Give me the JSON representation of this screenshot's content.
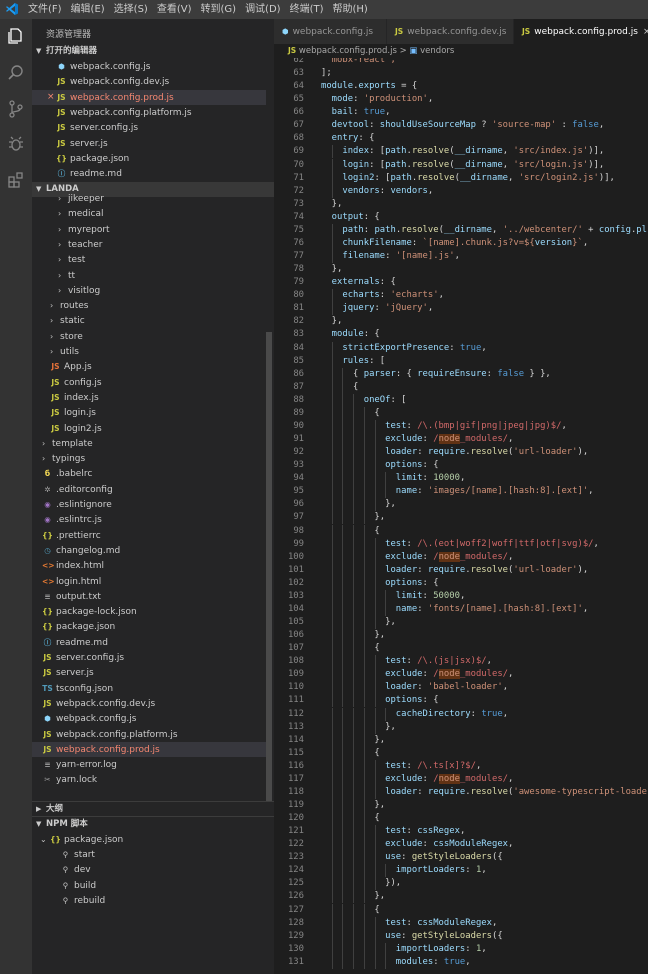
{
  "menu": [
    "文件(F)",
    "编辑(E)",
    "选择(S)",
    "查看(V)",
    "转到(G)",
    "调试(D)",
    "终端(T)",
    "帮助(H)"
  ],
  "sidebar_title": "资源管理器",
  "open_editors_label": "打开的编辑器",
  "open_editors": [
    {
      "name": "webpack.config.js",
      "icon": "webpack-icon"
    },
    {
      "name": "webpack.config.dev.js",
      "icon": "js-icon"
    },
    {
      "name": "webpack.config.prod.js",
      "icon": "js-icon",
      "selected": true,
      "error": true
    },
    {
      "name": "webpack.config.platform.js",
      "icon": "js-icon"
    },
    {
      "name": "server.config.js",
      "icon": "js-icon"
    },
    {
      "name": "server.js",
      "icon": "js-icon"
    },
    {
      "name": "package.json",
      "icon": "json-icon"
    },
    {
      "name": "readme.md",
      "icon": "info-icon"
    }
  ],
  "project_label": "LANDA",
  "tree": [
    {
      "name": "jikeeper",
      "depth": 2,
      "folder": true
    },
    {
      "name": "medical",
      "depth": 2,
      "folder": true
    },
    {
      "name": "myreport",
      "depth": 2,
      "folder": true
    },
    {
      "name": "teacher",
      "depth": 2,
      "folder": true
    },
    {
      "name": "test",
      "depth": 2,
      "folder": true
    },
    {
      "name": "tt",
      "depth": 2,
      "folder": true
    },
    {
      "name": "visitlog",
      "depth": 2,
      "folder": true
    },
    {
      "name": "routes",
      "depth": 1,
      "folder": true
    },
    {
      "name": "static",
      "depth": 1,
      "folder": true
    },
    {
      "name": "store",
      "depth": 1,
      "folder": true
    },
    {
      "name": "utils",
      "depth": 1,
      "folder": true
    },
    {
      "name": "App.js",
      "depth": 1,
      "icon": "js-react-icon"
    },
    {
      "name": "config.js",
      "depth": 1,
      "icon": "js-icon"
    },
    {
      "name": "index.js",
      "depth": 1,
      "icon": "js-icon"
    },
    {
      "name": "login.js",
      "depth": 1,
      "icon": "js-icon"
    },
    {
      "name": "login2.js",
      "depth": 1,
      "icon": "js-icon"
    },
    {
      "name": "template",
      "depth": 0,
      "folder": true
    },
    {
      "name": "typings",
      "depth": 0,
      "folder": true
    },
    {
      "name": ".babelrc",
      "depth": 0,
      "icon": "babel-icon"
    },
    {
      "name": ".editorconfig",
      "depth": 0,
      "icon": "settings-icon"
    },
    {
      "name": ".eslintignore",
      "depth": 0,
      "icon": "eslint-icon"
    },
    {
      "name": ".eslintrc.js",
      "depth": 0,
      "icon": "eslint-icon"
    },
    {
      "name": ".prettierrc",
      "depth": 0,
      "icon": "json-icon"
    },
    {
      "name": "changelog.md",
      "depth": 0,
      "icon": "clock-icon"
    },
    {
      "name": "index.html",
      "depth": 0,
      "icon": "html-icon"
    },
    {
      "name": "login.html",
      "depth": 0,
      "icon": "html-icon"
    },
    {
      "name": "output.txt",
      "depth": 0,
      "icon": "text-icon"
    },
    {
      "name": "package-lock.json",
      "depth": 0,
      "icon": "json-icon"
    },
    {
      "name": "package.json",
      "depth": 0,
      "icon": "json-icon"
    },
    {
      "name": "readme.md",
      "depth": 0,
      "icon": "info-icon"
    },
    {
      "name": "server.config.js",
      "depth": 0,
      "icon": "js-icon"
    },
    {
      "name": "server.js",
      "depth": 0,
      "icon": "js-icon"
    },
    {
      "name": "tsconfig.json",
      "depth": 0,
      "icon": "ts-icon"
    },
    {
      "name": "webpack.config.dev.js",
      "depth": 0,
      "icon": "js-icon"
    },
    {
      "name": "webpack.config.js",
      "depth": 0,
      "icon": "webpack-icon"
    },
    {
      "name": "webpack.config.platform.js",
      "depth": 0,
      "icon": "js-icon"
    },
    {
      "name": "webpack.config.prod.js",
      "depth": 0,
      "icon": "js-icon",
      "selected": true,
      "error": true
    },
    {
      "name": "yarn-error.log",
      "depth": 0,
      "icon": "lines-icon"
    },
    {
      "name": "yarn.lock",
      "depth": 0,
      "icon": "yarn-icon"
    }
  ],
  "outline_label": "大纲",
  "npm_label": "NPM 脚本",
  "npm_package": "package.json",
  "npm_scripts": [
    "start",
    "dev",
    "build",
    "rebuild"
  ],
  "tabs": [
    {
      "name": "webpack.config.js",
      "icon": "webpack-icon"
    },
    {
      "name": "webpack.config.dev.js",
      "icon": "js-icon"
    },
    {
      "name": "webpack.config.prod.js",
      "icon": "js-icon",
      "active": true
    }
  ],
  "tab_close": "×",
  "breadcrumb": {
    "file": "webpack.config.prod.js",
    "sep": ">",
    "symbol": "vendors"
  },
  "code_start_line": 62,
  "code_lines": [
    [
      [
        "s",
        "  mobx-react',"
      ]
    ],
    [
      [
        "p",
        "];"
      ]
    ],
    [
      [
        "v",
        "module"
      ],
      [
        "p",
        "."
      ],
      [
        "v",
        "exports"
      ],
      [
        "p",
        " = {"
      ]
    ],
    [
      [
        "v",
        "  mode"
      ],
      [
        "p",
        ": "
      ],
      [
        "s",
        "'production'"
      ],
      [
        "p",
        ","
      ]
    ],
    [
      [
        "v",
        "  bail"
      ],
      [
        "p",
        ": "
      ],
      [
        "k",
        "true"
      ],
      [
        "p",
        ","
      ]
    ],
    [
      [
        "v",
        "  devtool"
      ],
      [
        "p",
        ": "
      ],
      [
        "v",
        "shouldUseSourceMap"
      ],
      [
        "p",
        " ? "
      ],
      [
        "s",
        "'source-map'"
      ],
      [
        "p",
        " : "
      ],
      [
        "k",
        "false"
      ],
      [
        "p",
        ","
      ]
    ],
    [
      [
        "v",
        "  entry"
      ],
      [
        "p",
        ": {"
      ]
    ],
    [
      [
        "v",
        "    index"
      ],
      [
        "p",
        ": ["
      ],
      [
        "v",
        "path"
      ],
      [
        "p",
        "."
      ],
      [
        "f",
        "resolve"
      ],
      [
        "p",
        "("
      ],
      [
        "v",
        "__dirname"
      ],
      [
        "p",
        ", "
      ],
      [
        "s",
        "'src/index.js'"
      ],
      [
        "p",
        ")],"
      ]
    ],
    [
      [
        "v",
        "    login"
      ],
      [
        "p",
        ": ["
      ],
      [
        "v",
        "path"
      ],
      [
        "p",
        "."
      ],
      [
        "f",
        "resolve"
      ],
      [
        "p",
        "("
      ],
      [
        "v",
        "__dirname"
      ],
      [
        "p",
        ", "
      ],
      [
        "s",
        "'src/login.js'"
      ],
      [
        "p",
        ")],"
      ]
    ],
    [
      [
        "v",
        "    login2"
      ],
      [
        "p",
        ": ["
      ],
      [
        "v",
        "path"
      ],
      [
        "p",
        "."
      ],
      [
        "f",
        "resolve"
      ],
      [
        "p",
        "("
      ],
      [
        "v",
        "__dirname"
      ],
      [
        "p",
        ", "
      ],
      [
        "s",
        "'src/login2.js'"
      ],
      [
        "p",
        ")],"
      ]
    ],
    [
      [
        "v",
        "    vendors"
      ],
      [
        "p",
        ": "
      ],
      [
        "v",
        "vendors"
      ],
      [
        "p",
        ","
      ]
    ],
    [
      [
        "p",
        "  },"
      ]
    ],
    [
      [
        "v",
        "  output"
      ],
      [
        "p",
        ": {"
      ]
    ],
    [
      [
        "v",
        "    path"
      ],
      [
        "p",
        ": "
      ],
      [
        "v",
        "path"
      ],
      [
        "p",
        "."
      ],
      [
        "f",
        "resolve"
      ],
      [
        "p",
        "("
      ],
      [
        "v",
        "__dirname"
      ],
      [
        "p",
        ", "
      ],
      [
        "s",
        "'../webcenter/'"
      ],
      [
        "p",
        " + "
      ],
      [
        "v",
        "config"
      ],
      [
        "p",
        "."
      ],
      [
        "v",
        "pl"
      ]
    ],
    [
      [
        "v",
        "    chunkFilename"
      ],
      [
        "p",
        ": "
      ],
      [
        "s",
        "`[name].chunk.js?v=${"
      ],
      [
        "v",
        "version"
      ],
      [
        "s",
        "}`"
      ],
      [
        "p",
        ","
      ]
    ],
    [
      [
        "v",
        "    filename"
      ],
      [
        "p",
        ": "
      ],
      [
        "s",
        "'[name].js'"
      ],
      [
        "p",
        ","
      ]
    ],
    [
      [
        "p",
        "  },"
      ]
    ],
    [
      [
        "v",
        "  externals"
      ],
      [
        "p",
        ": {"
      ]
    ],
    [
      [
        "v",
        "    echarts"
      ],
      [
        "p",
        ": "
      ],
      [
        "s",
        "'echarts'"
      ],
      [
        "p",
        ","
      ]
    ],
    [
      [
        "v",
        "    jquery"
      ],
      [
        "p",
        ": "
      ],
      [
        "s",
        "'jQuery'"
      ],
      [
        "p",
        ","
      ]
    ],
    [
      [
        "p",
        "  },"
      ]
    ],
    [
      [
        "v",
        "  module"
      ],
      [
        "p",
        ": {"
      ]
    ],
    [
      [
        "v",
        "    strictExportPresence"
      ],
      [
        "p",
        ": "
      ],
      [
        "k",
        "true"
      ],
      [
        "p",
        ","
      ]
    ],
    [
      [
        "v",
        "    rules"
      ],
      [
        "p",
        ": ["
      ]
    ],
    [
      [
        "p",
        "      { "
      ],
      [
        "v",
        "parser"
      ],
      [
        "p",
        ": { "
      ],
      [
        "v",
        "requireEnsure"
      ],
      [
        "p",
        ": "
      ],
      [
        "k",
        "false"
      ],
      [
        "p",
        " } },"
      ]
    ],
    [
      [
        "p",
        "      {"
      ]
    ],
    [
      [
        "v",
        "        oneOf"
      ],
      [
        "p",
        ": ["
      ]
    ],
    [
      [
        "p",
        "          {"
      ]
    ],
    [
      [
        "v",
        "            test"
      ],
      [
        "p",
        ": "
      ],
      [
        "r",
        "/\\.(bmp|gif|png|jpeg|jpg)$/"
      ],
      [
        "p",
        ","
      ]
    ],
    [
      [
        "v",
        "            exclude"
      ],
      [
        "p",
        ": "
      ],
      [
        "r",
        "/"
      ],
      [
        "ex",
        "node"
      ],
      [
        "r",
        "_modules/"
      ],
      [
        "p",
        ","
      ]
    ],
    [
      [
        "v",
        "            loader"
      ],
      [
        "p",
        ": "
      ],
      [
        "v",
        "require"
      ],
      [
        "p",
        "."
      ],
      [
        "f",
        "resolve"
      ],
      [
        "p",
        "("
      ],
      [
        "s",
        "'url-loader'"
      ],
      [
        "p",
        "),"
      ]
    ],
    [
      [
        "v",
        "            options"
      ],
      [
        "p",
        ": {"
      ]
    ],
    [
      [
        "v",
        "              limit"
      ],
      [
        "p",
        ": "
      ],
      [
        "n",
        "10000"
      ],
      [
        "p",
        ","
      ]
    ],
    [
      [
        "v",
        "              name"
      ],
      [
        "p",
        ": "
      ],
      [
        "s",
        "'images/[name].[hash:8].[ext]'"
      ],
      [
        "p",
        ","
      ]
    ],
    [
      [
        "p",
        "            },"
      ]
    ],
    [
      [
        "p",
        "          },"
      ]
    ],
    [
      [
        "p",
        "          {"
      ]
    ],
    [
      [
        "v",
        "            test"
      ],
      [
        "p",
        ": "
      ],
      [
        "r",
        "/\\.(eot|woff2|woff|ttf|otf|svg)$/"
      ],
      [
        "p",
        ","
      ]
    ],
    [
      [
        "v",
        "            exclude"
      ],
      [
        "p",
        ": "
      ],
      [
        "r",
        "/"
      ],
      [
        "ex",
        "node"
      ],
      [
        "r",
        "_modules/"
      ],
      [
        "p",
        ","
      ]
    ],
    [
      [
        "v",
        "            loader"
      ],
      [
        "p",
        ": "
      ],
      [
        "v",
        "require"
      ],
      [
        "p",
        "."
      ],
      [
        "f",
        "resolve"
      ],
      [
        "p",
        "("
      ],
      [
        "s",
        "'url-loader'"
      ],
      [
        "p",
        "),"
      ]
    ],
    [
      [
        "v",
        "            options"
      ],
      [
        "p",
        ": {"
      ]
    ],
    [
      [
        "v",
        "              limit"
      ],
      [
        "p",
        ": "
      ],
      [
        "n",
        "50000"
      ],
      [
        "p",
        ","
      ]
    ],
    [
      [
        "v",
        "              name"
      ],
      [
        "p",
        ": "
      ],
      [
        "s",
        "'fonts/[name].[hash:8].[ext]'"
      ],
      [
        "p",
        ","
      ]
    ],
    [
      [
        "p",
        "            },"
      ]
    ],
    [
      [
        "p",
        "          },"
      ]
    ],
    [
      [
        "p",
        "          {"
      ]
    ],
    [
      [
        "v",
        "            test"
      ],
      [
        "p",
        ": "
      ],
      [
        "r",
        "/\\.(js|jsx)$/"
      ],
      [
        "p",
        ","
      ]
    ],
    [
      [
        "v",
        "            exclude"
      ],
      [
        "p",
        ": "
      ],
      [
        "r",
        "/"
      ],
      [
        "ex",
        "node"
      ],
      [
        "r",
        "_modules/"
      ],
      [
        "p",
        ","
      ]
    ],
    [
      [
        "v",
        "            loader"
      ],
      [
        "p",
        ": "
      ],
      [
        "s",
        "'babel-loader'"
      ],
      [
        "p",
        ","
      ]
    ],
    [
      [
        "v",
        "            options"
      ],
      [
        "p",
        ": {"
      ]
    ],
    [
      [
        "v",
        "              cacheDirectory"
      ],
      [
        "p",
        ": "
      ],
      [
        "k",
        "true"
      ],
      [
        "p",
        ","
      ]
    ],
    [
      [
        "p",
        "            },"
      ]
    ],
    [
      [
        "p",
        "          },"
      ]
    ],
    [
      [
        "p",
        "          {"
      ]
    ],
    [
      [
        "v",
        "            test"
      ],
      [
        "p",
        ": "
      ],
      [
        "r",
        "/\\.ts[x]?$/"
      ],
      [
        "p",
        ","
      ]
    ],
    [
      [
        "v",
        "            exclude"
      ],
      [
        "p",
        ": "
      ],
      [
        "r",
        "/"
      ],
      [
        "ex",
        "node"
      ],
      [
        "r",
        "_modules/"
      ],
      [
        "p",
        ","
      ]
    ],
    [
      [
        "v",
        "            loader"
      ],
      [
        "p",
        ": "
      ],
      [
        "v",
        "require"
      ],
      [
        "p",
        "."
      ],
      [
        "f",
        "resolve"
      ],
      [
        "p",
        "("
      ],
      [
        "s",
        "'awesome-typescript-loade"
      ]
    ],
    [
      [
        "p",
        "          },"
      ]
    ],
    [
      [
        "p",
        "          {"
      ]
    ],
    [
      [
        "v",
        "            test"
      ],
      [
        "p",
        ": "
      ],
      [
        "v",
        "cssRegex"
      ],
      [
        "p",
        ","
      ]
    ],
    [
      [
        "v",
        "            exclude"
      ],
      [
        "p",
        ": "
      ],
      [
        "v",
        "cssModuleRegex"
      ],
      [
        "p",
        ","
      ]
    ],
    [
      [
        "v",
        "            use"
      ],
      [
        "p",
        ": "
      ],
      [
        "f",
        "getStyleLoaders"
      ],
      [
        "p",
        "({"
      ]
    ],
    [
      [
        "v",
        "              importLoaders"
      ],
      [
        "p",
        ": "
      ],
      [
        "n",
        "1"
      ],
      [
        "p",
        ","
      ]
    ],
    [
      [
        "p",
        "            }),"
      ]
    ],
    [
      [
        "p",
        "          },"
      ]
    ],
    [
      [
        "p",
        "          {"
      ]
    ],
    [
      [
        "v",
        "            test"
      ],
      [
        "p",
        ": "
      ],
      [
        "v",
        "cssModuleRegex"
      ],
      [
        "p",
        ","
      ]
    ],
    [
      [
        "v",
        "            use"
      ],
      [
        "p",
        ": "
      ],
      [
        "f",
        "getStyleLoaders"
      ],
      [
        "p",
        "({"
      ]
    ],
    [
      [
        "v",
        "              importLoaders"
      ],
      [
        "p",
        ": "
      ],
      [
        "n",
        "1"
      ],
      [
        "p",
        ","
      ]
    ],
    [
      [
        "v",
        "              modules"
      ],
      [
        "p",
        ": "
      ],
      [
        "k",
        "true"
      ],
      [
        "p",
        ","
      ]
    ]
  ]
}
